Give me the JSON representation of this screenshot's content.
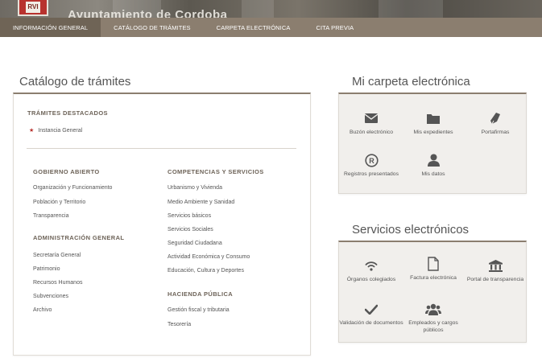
{
  "banner": {
    "title_fragment": "Ayuntamiento de Cordoba",
    "logo_text": "RVI"
  },
  "nav": {
    "items": [
      {
        "label": "INFORMACIÓN GENERAL",
        "active": true
      },
      {
        "label": "CATÁLOGO DE TRÁMITES",
        "active": false
      },
      {
        "label": "CARPETA ELECTRÓNICA",
        "active": false
      },
      {
        "label": "CITA PREVIA",
        "active": false
      }
    ]
  },
  "catalog": {
    "title": "Catálogo de trámites",
    "featured_heading": "TRÁMITES DESTACADOS",
    "featured_item": "Instancia General",
    "gobierno_heading": "GOBIERNO ABIERTO",
    "gobierno_items": [
      "Organización y Funcionamiento",
      "Población y Territorio",
      "Transparencia"
    ],
    "admin_heading": "ADMINISTRACIÓN GENERAL",
    "admin_items": [
      "Secretaría General",
      "Patrimonio",
      "Recursos Humanos",
      "Subvenciones",
      "Archivo"
    ],
    "competencias_heading": "COMPETENCIAS Y SERVICIOS",
    "competencias_items": [
      "Urbanismo y Vivienda",
      "Medio Ambiente y Sanidad",
      "Servicios básicos",
      "Servicios Sociales",
      "Seguridad Ciudadana",
      "Actividad Económica y Consumo",
      "Educación, Cultura y Deportes"
    ],
    "hacienda_heading": "HACIENDA PÚBLICA",
    "hacienda_items": [
      "Gestión fiscal y tributaria",
      "Tesorería"
    ]
  },
  "carpeta": {
    "title": "Mi carpeta electrónica",
    "tiles": [
      {
        "icon": "envelope-icon",
        "label": "Buzón electrónico"
      },
      {
        "icon": "folder-icon",
        "label": "Mis expedientes"
      },
      {
        "icon": "pen-icon",
        "label": "Portafirmas"
      },
      {
        "icon": "registered-icon",
        "label": "Registros presentados"
      },
      {
        "icon": "user-icon",
        "label": "Mis datos"
      }
    ]
  },
  "servicios": {
    "title": "Servicios electrónicos",
    "tiles": [
      {
        "icon": "broadcast-icon",
        "label": "Órganos colegiados"
      },
      {
        "icon": "document-icon",
        "label": "Factura electrónica"
      },
      {
        "icon": "institution-icon",
        "label": "Portal de transparencia"
      },
      {
        "icon": "checkmark-icon",
        "label": "Validación de documentos"
      },
      {
        "icon": "group-icon",
        "label": "Empleados y cargos públicos"
      }
    ]
  },
  "colors": {
    "nav_bg": "#8b7e6f",
    "nav_active": "#6f6456",
    "accent_red": "#b8322e",
    "icon": "#555555"
  }
}
